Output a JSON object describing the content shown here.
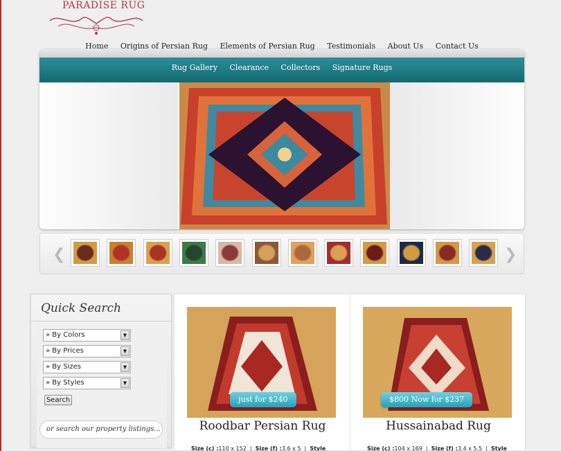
{
  "brand": {
    "logo_text": "PARADISE RUG"
  },
  "top_nav": [
    "Home",
    "Origins of Persian Rug",
    "Elements of Persian Rug",
    "Testimonials",
    "About Us",
    "Contact Us"
  ],
  "sub_nav": [
    "Rug Gallery",
    "Clearance",
    "Collectors",
    "Signature Rugs"
  ],
  "thumbnails": [
    {
      "c1": "#d39a44",
      "c2": "#6a2a1e"
    },
    {
      "c1": "#c8822e",
      "c2": "#b0302a"
    },
    {
      "c1": "#d8a050",
      "c2": "#a83424"
    },
    {
      "c1": "#3e7a48",
      "c2": "#24452c"
    },
    {
      "c1": "#d8b8a8",
      "c2": "#8a3a3a"
    },
    {
      "c1": "#8a5a38",
      "c2": "#d7a05a"
    },
    {
      "c1": "#e0a060",
      "c2": "#a86a3a"
    },
    {
      "c1": "#a02c30",
      "c2": "#d8a050"
    },
    {
      "c1": "#d39a44",
      "c2": "#6a1c1c"
    },
    {
      "c1": "#1c2a4a",
      "c2": "#d39a44"
    },
    {
      "c1": "#d49848",
      "c2": "#8a2a22"
    },
    {
      "c1": "#d8a050",
      "c2": "#2a2a4a"
    }
  ],
  "quick_search": {
    "title": "Quick Search",
    "selects": [
      "» By Colors",
      "» By Prices",
      "» By Sizes",
      "» By Styles"
    ],
    "button_label": "Search",
    "search_placeholder": "or search our property listings..."
  },
  "listings": [
    {
      "title": "Roodbar Persian Rug",
      "price": "just for $240",
      "size_c_label": "Size (c) :",
      "size_c": "110 x 152",
      "size_f_label": "Size (f) :",
      "size_f": "3.6 x 5",
      "style_label": "Style"
    },
    {
      "title": "Hussainabad Rug",
      "price": "$800 Now for $237",
      "size_c_label": "Size (c) :",
      "size_c": "104 x 169",
      "size_f_label": "Size (f) :",
      "size_f": "3.4 x 5.5",
      "style_label": "Style"
    }
  ],
  "colors": {
    "teal": "#1f7c86",
    "price_tag": "#3bb3c8",
    "logo": "#b03a4a"
  }
}
